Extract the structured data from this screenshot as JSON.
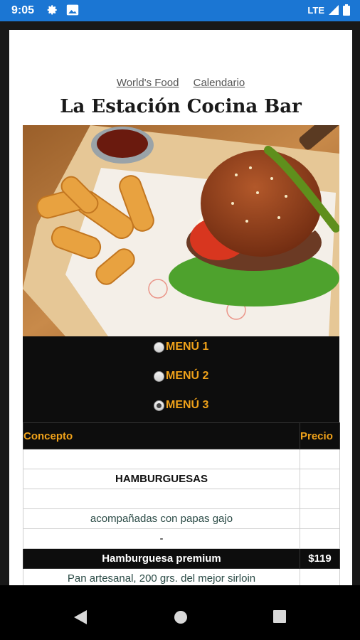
{
  "status": {
    "time": "9:05",
    "network": "LTE"
  },
  "links": {
    "worlds_food": "World's Food",
    "calendario": "Calendario"
  },
  "title": "La Estación Cocina Bar",
  "menu_options": [
    {
      "label": "MENÚ 1",
      "selected": false
    },
    {
      "label": "MENÚ 2",
      "selected": false
    },
    {
      "label": "MENÚ 3",
      "selected": true
    }
  ],
  "table": {
    "headers": {
      "concept": "Concepto",
      "price": "Precio"
    },
    "section": "HAMBURGUESAS",
    "note": "acompañadas con papas gajo",
    "dash": "-",
    "item": {
      "name": "Hamburguesa premium",
      "price": "$119"
    },
    "description": "Pan artesanal, 200 grs. del mejor sirloin"
  },
  "colors": {
    "status_bar": "#1b76d3",
    "accent": "#f0a21a",
    "panel": "#0d0d0d"
  }
}
